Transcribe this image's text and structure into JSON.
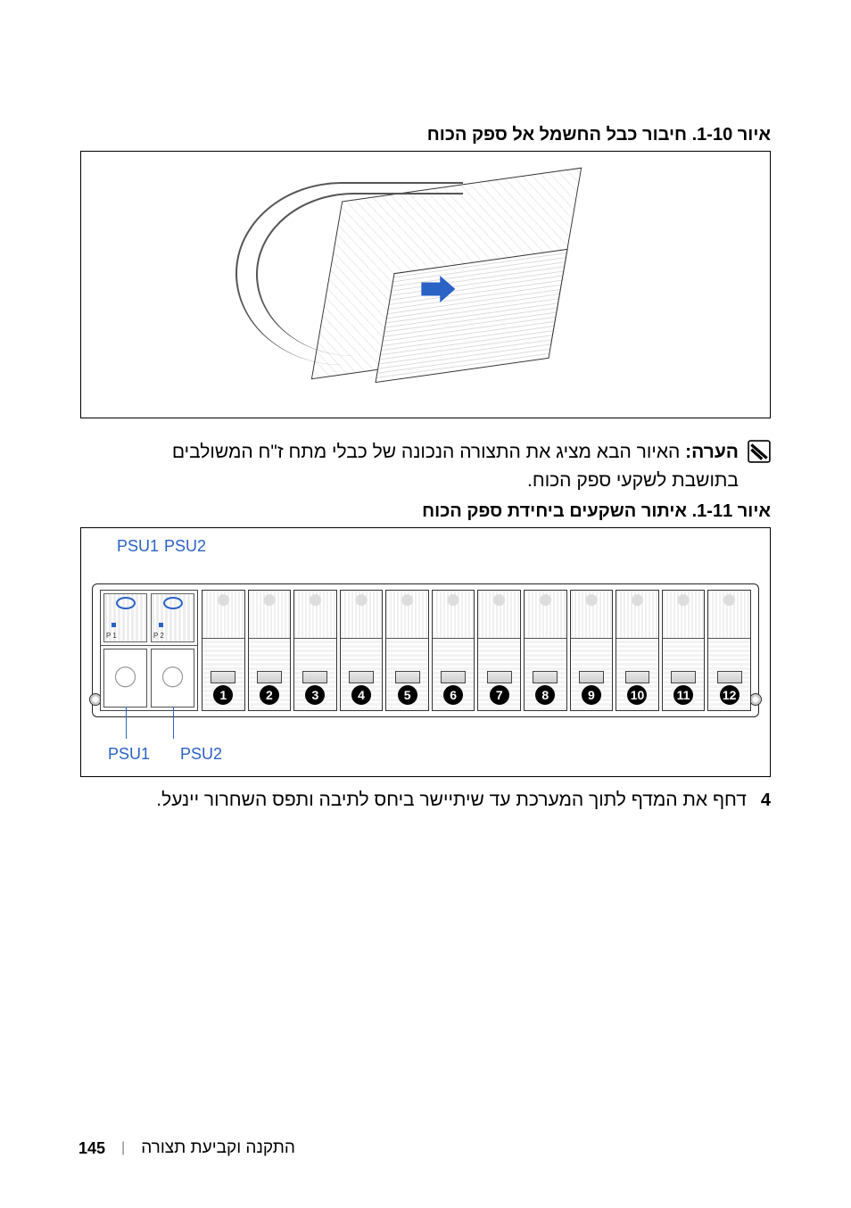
{
  "figure1": {
    "title": "איור 1-10. חיבור כבל החשמל אל ספק הכוח"
  },
  "note": {
    "label": "הערה:",
    "text": "האיור הבא מציג את התצורה הנכונה של כבלי מתח ז\"ח המשולבים בתושבת לשקעי ספק הכוח."
  },
  "figure2": {
    "title": "איור 1-11. איתור השקעים ביחידת ספק הכוח",
    "top_label_psu1": "PSU1",
    "top_label_psu2": "PSU2",
    "bottom_label_psu1": "PSU1",
    "bottom_label_psu2": "PSU2",
    "psu_inner_label_1": "P 1",
    "psu_inner_label_2": "P 2",
    "slots": [
      "1",
      "2",
      "3",
      "4",
      "5",
      "6",
      "7",
      "8",
      "9",
      "10",
      "11",
      "12"
    ]
  },
  "step": {
    "num": "4",
    "text": "דחף את המדף לתוך המערכת עד שיתיישר ביחס לתיבה ותפס השחרור יינעל."
  },
  "footer": {
    "page": "145",
    "section": "התקנה וקביעת תצורה"
  }
}
